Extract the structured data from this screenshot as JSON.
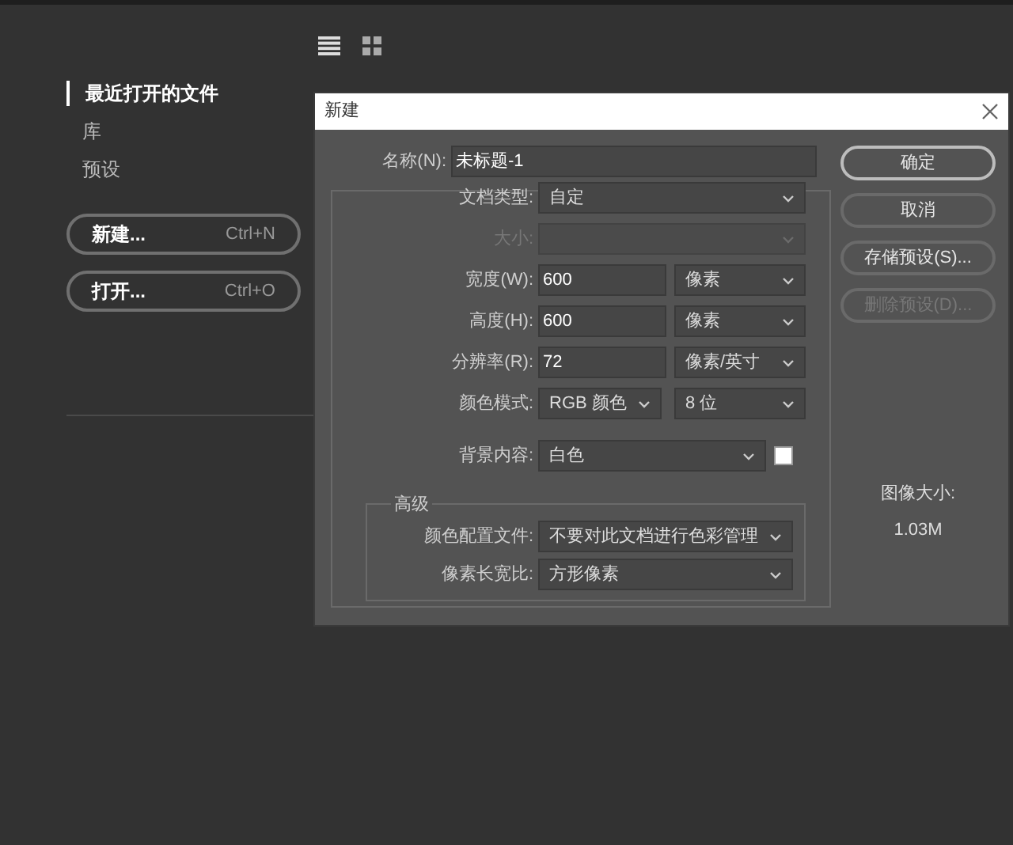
{
  "sidebar": {
    "items": [
      {
        "label": "最近打开的文件",
        "selected": true
      },
      {
        "label": "库",
        "selected": false
      },
      {
        "label": "预设",
        "selected": false
      }
    ],
    "buttons": [
      {
        "label": "新建...",
        "shortcut": "Ctrl+N"
      },
      {
        "label": "打开...",
        "shortcut": "Ctrl+O"
      }
    ]
  },
  "dialog": {
    "title": "新建",
    "name_field": {
      "label": "名称(N):",
      "value": "未标题-1"
    },
    "fields": [
      {
        "kind": "select",
        "label": "文档类型:",
        "value": "自定",
        "disabled": false
      },
      {
        "kind": "select",
        "label": "大小:",
        "disabled": true
      },
      {
        "kind": "input_select",
        "label": "宽度(W):",
        "value": "600",
        "unit": "像素"
      },
      {
        "kind": "input_select",
        "label": "高度(H):",
        "value": "600",
        "unit": "像素"
      },
      {
        "kind": "input_select",
        "label": "分辨率(R):",
        "value": "72",
        "unit": "像素/英寸"
      },
      {
        "kind": "select_pair",
        "label": "颜色模式:",
        "value": "RGB 颜色",
        "unit": "8 位"
      },
      {
        "kind": "select_swatch",
        "label": "背景内容:",
        "value": "白色",
        "color": "#ffffff"
      }
    ],
    "advanced": {
      "title": "高级",
      "fields": [
        {
          "label": "颜色配置文件:",
          "value": "不要对此文档进行色彩管理"
        },
        {
          "label": "像素长宽比:",
          "value": "方形像素"
        }
      ]
    },
    "buttons": [
      {
        "label": "确定",
        "default": true,
        "disabled": false
      },
      {
        "label": "取消",
        "default": false,
        "disabled": false
      },
      {
        "label": "存储预设(S)...",
        "default": false,
        "disabled": false
      },
      {
        "label": "删除预设(D)...",
        "default": false,
        "disabled": true
      }
    ],
    "image_size": {
      "label": "图像大小:",
      "value": "1.03M"
    }
  }
}
